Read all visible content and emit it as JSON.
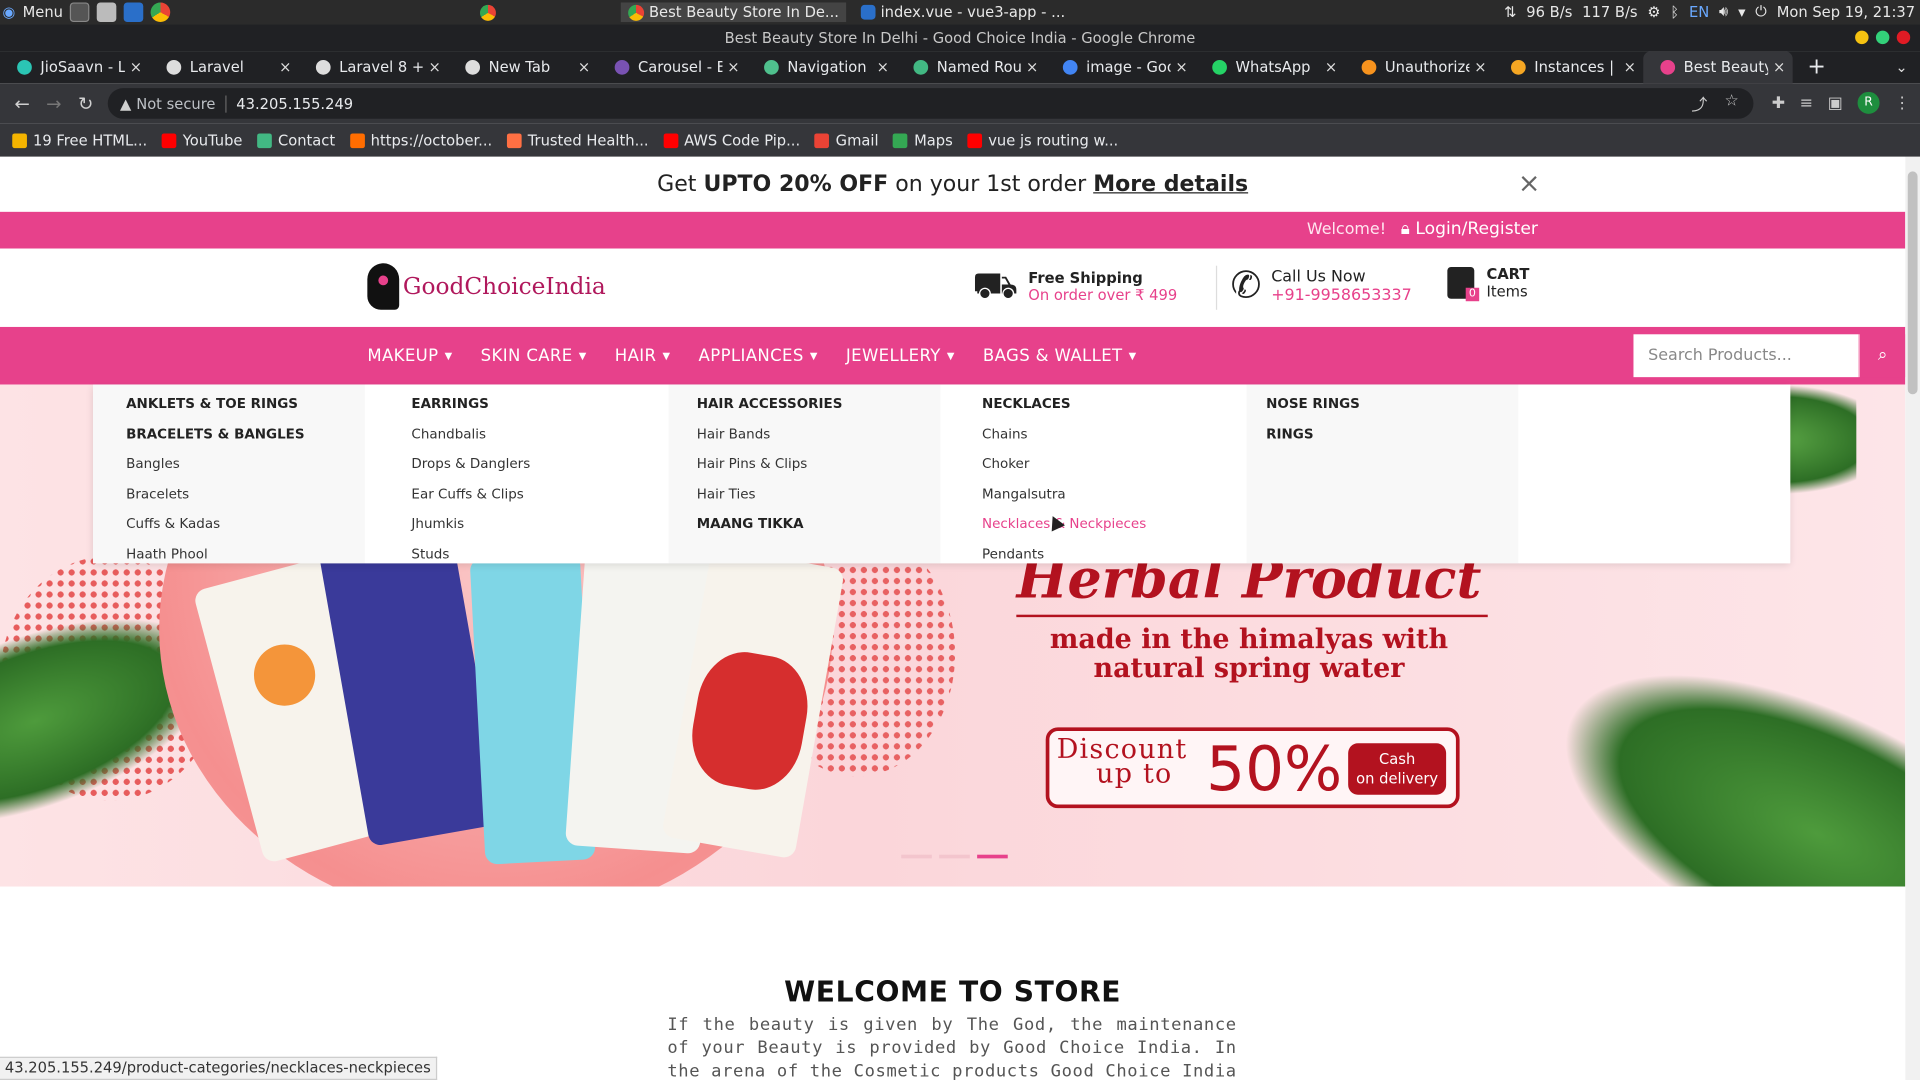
{
  "os": {
    "menu_label": "Menu",
    "active_task": "Best Beauty Store In De...",
    "task2": "index.vue - vue3-app - ...",
    "net_down": "96 B/s",
    "net_up": "117 B/s",
    "lang": "EN",
    "datetime": "Mon Sep 19, 21:37"
  },
  "window_title": "Best Beauty Store In Delhi - Good Choice India - Google Chrome",
  "tabs": [
    {
      "label": "JioSaavn - Li",
      "color": "#2bc5b4"
    },
    {
      "label": "Laravel",
      "color": "#dddddd"
    },
    {
      "label": "Laravel 8 + V",
      "color": "#dddddd"
    },
    {
      "label": "New Tab",
      "color": "#dddddd"
    },
    {
      "label": "Carousel - B",
      "color": "#7952b3"
    },
    {
      "label": "Navigation",
      "color": "#4fc08d"
    },
    {
      "label": "Named Rout",
      "color": "#42b883"
    },
    {
      "label": "image - Goo",
      "color": "#4285f4"
    },
    {
      "label": "WhatsApp",
      "color": "#25d366"
    },
    {
      "label": "Unauthorize",
      "color": "#f7931e"
    },
    {
      "label": "Instances | E",
      "color": "#f5a623"
    },
    {
      "label": "Best Beauty",
      "color": "#e7418b"
    }
  ],
  "toolbar": {
    "not_secure": "Not secure",
    "url": "43.205.155.249",
    "profile_initial": "R"
  },
  "bookmarks": [
    {
      "label": "19 Free HTML...",
      "color": "#f4b400"
    },
    {
      "label": "YouTube",
      "color": "#ff0000"
    },
    {
      "label": "Contact",
      "color": "#42b883"
    },
    {
      "label": "https://october...",
      "color": "#ff6d00"
    },
    {
      "label": "Trusted Health...",
      "color": "#ff7043"
    },
    {
      "label": "AWS Code Pip...",
      "color": "#ff0000"
    },
    {
      "label": "Gmail",
      "color": "#ea4335"
    },
    {
      "label": "Maps",
      "color": "#34a853"
    },
    {
      "label": "vue js routing w...",
      "color": "#ff0000"
    }
  ],
  "promo": {
    "prefix": "Get ",
    "bold": "UPTO 20% OFF",
    "middle": " on your 1st order ",
    "link": "More details",
    "close": "×"
  },
  "topbar": {
    "welcome": "Welcome!",
    "login": "Login/Register"
  },
  "header": {
    "logo_text": "GoodChoiceIndia",
    "shipping_title": "Free Shipping",
    "shipping_sub": "On order over ₹ 499",
    "call_title": "Call Us Now",
    "call_number": "+91-9958653337",
    "cart_title": "CART",
    "cart_sub": "Items",
    "cart_count": "0"
  },
  "nav": {
    "items": [
      "MAKEUP",
      "SKIN CARE",
      "HAIR",
      "APPLIANCES",
      "JEWELLERY",
      "BAGS & WALLET"
    ],
    "search_placeholder": "Search Products..."
  },
  "mega_menu": {
    "col1": [
      "ANKLETS & TOE RINGS",
      "BRACELETS & BANGLES",
      "Bangles",
      "Bracelets",
      "Cuffs & Kadas",
      "Haath Phool"
    ],
    "col2": [
      "EARRINGS",
      "Chandbalis",
      "Drops & Danglers",
      "Ear Cuffs & Clips",
      "Jhumkis",
      "Studs"
    ],
    "col3": [
      "HAIR ACCESSORIES",
      "Hair Bands",
      "Hair Pins & Clips",
      "Hair Ties",
      "MAANG TIKKA"
    ],
    "col4": [
      "NECKLACES",
      "Chains",
      "Choker",
      "Mangalsutra",
      "Necklaces & Neckpieces",
      "Pendants"
    ],
    "col5": [
      "NOSE RINGS",
      "RINGS"
    ]
  },
  "hero": {
    "title": "Herbal Product",
    "subtitle_line1": "made in the himalyas with",
    "subtitle_line2": "natural spring water",
    "discount_line1": "Discount",
    "discount_line2": "up to",
    "discount_value": "50%",
    "cod_line1": "Cash",
    "cod_line2": "on delivery",
    "slides_total": 3,
    "active_slide": 3
  },
  "welcome": {
    "title": "WELCOME TO STORE",
    "text": "If the beauty is given by The God, the maintenance of your Beauty is provided by Good Choice India. In the arena of the Cosmetic products Good Choice India is a fastest growing"
  },
  "status_url": "43.205.155.249/product-categories/necklaces-neckpieces",
  "colors": {
    "brand_pink": "#e7418b",
    "hero_red": "#b3121f"
  }
}
